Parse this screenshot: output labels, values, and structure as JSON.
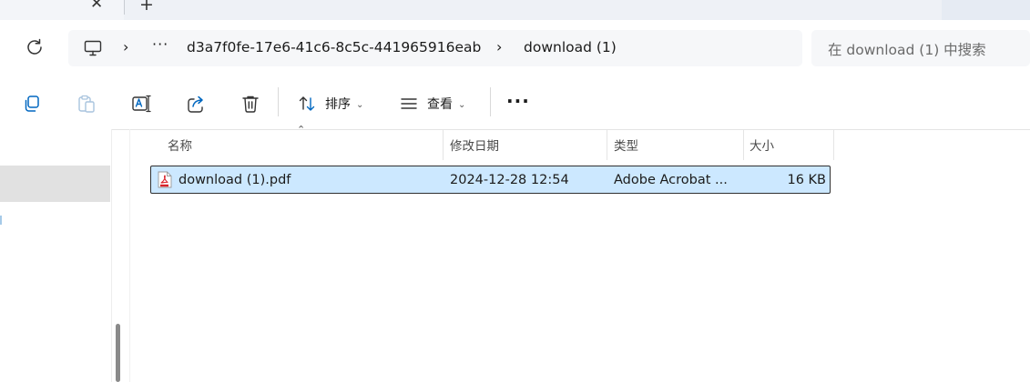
{
  "tab": {
    "close_glyph": "✕",
    "new_tab_glyph": "+"
  },
  "address": {
    "more_glyph": "···",
    "path": [
      "d3a7f0fe-17e6-41c6-8c5c-441965916eab",
      "download (1)"
    ],
    "separator": "›"
  },
  "search": {
    "placeholder": "在 download (1) 中搜索"
  },
  "toolbar": {
    "icons": [
      "copy-icon",
      "paste-icon",
      "rename-icon",
      "share-icon",
      "delete-icon"
    ],
    "sort_label": "排序",
    "view_label": "查看",
    "caret": "⌄",
    "more_glyph": "···"
  },
  "columns": {
    "name": "名称",
    "modified": "修改日期",
    "type": "类型",
    "size": "大小"
  },
  "files": [
    {
      "name": "download (1).pdf",
      "modified": "2024-12-28 12:54",
      "type": "Adobe Acrobat ...",
      "size": "16 KB",
      "icon": "pdf-icon",
      "selected": true
    }
  ],
  "colors": {
    "selection": "#cce8ff",
    "accent": "#0067c0",
    "pdf_red": "#d8232a"
  }
}
